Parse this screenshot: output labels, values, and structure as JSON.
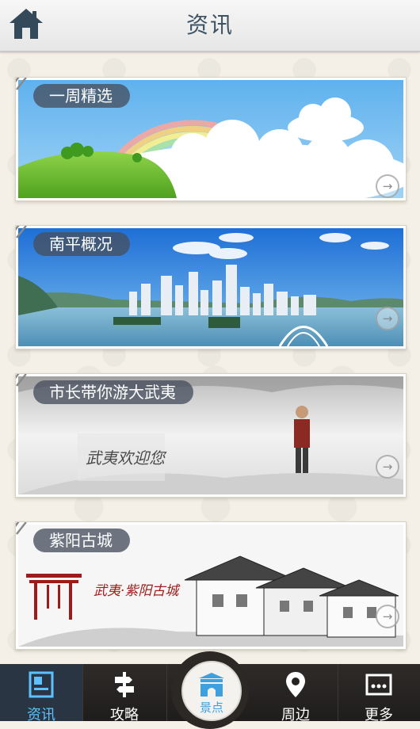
{
  "header": {
    "title": "资讯",
    "home_icon": "home-icon"
  },
  "cards": [
    {
      "label": "一周精选",
      "arrow_icon": "arrow-right-circle-icon"
    },
    {
      "label": "南平概况",
      "arrow_icon": "arrow-right-circle-icon"
    },
    {
      "label": "市长带你游大武夷",
      "arrow_icon": "arrow-right-circle-icon",
      "calligraphy": "武夷欢迎您"
    },
    {
      "label": "紫阳古城",
      "arrow_icon": "arrow-right-circle-icon",
      "calligraphy": "武夷·紫阳古城"
    }
  ],
  "tabbar": {
    "items": [
      {
        "label": "资讯",
        "icon": "news-icon",
        "active": true
      },
      {
        "label": "攻略",
        "icon": "signpost-icon",
        "active": false
      },
      {
        "label": "景点",
        "icon": "gate-icon",
        "active": false
      },
      {
        "label": "周边",
        "icon": "location-pin-icon",
        "active": false
      },
      {
        "label": "更多",
        "icon": "more-icon",
        "active": false
      }
    ]
  },
  "colors": {
    "header_text": "#3f5262",
    "active_tab_text": "#5ec1ff",
    "center_tab_text": "#3ea0de",
    "tabbar_bg": "#1f1d1c"
  }
}
